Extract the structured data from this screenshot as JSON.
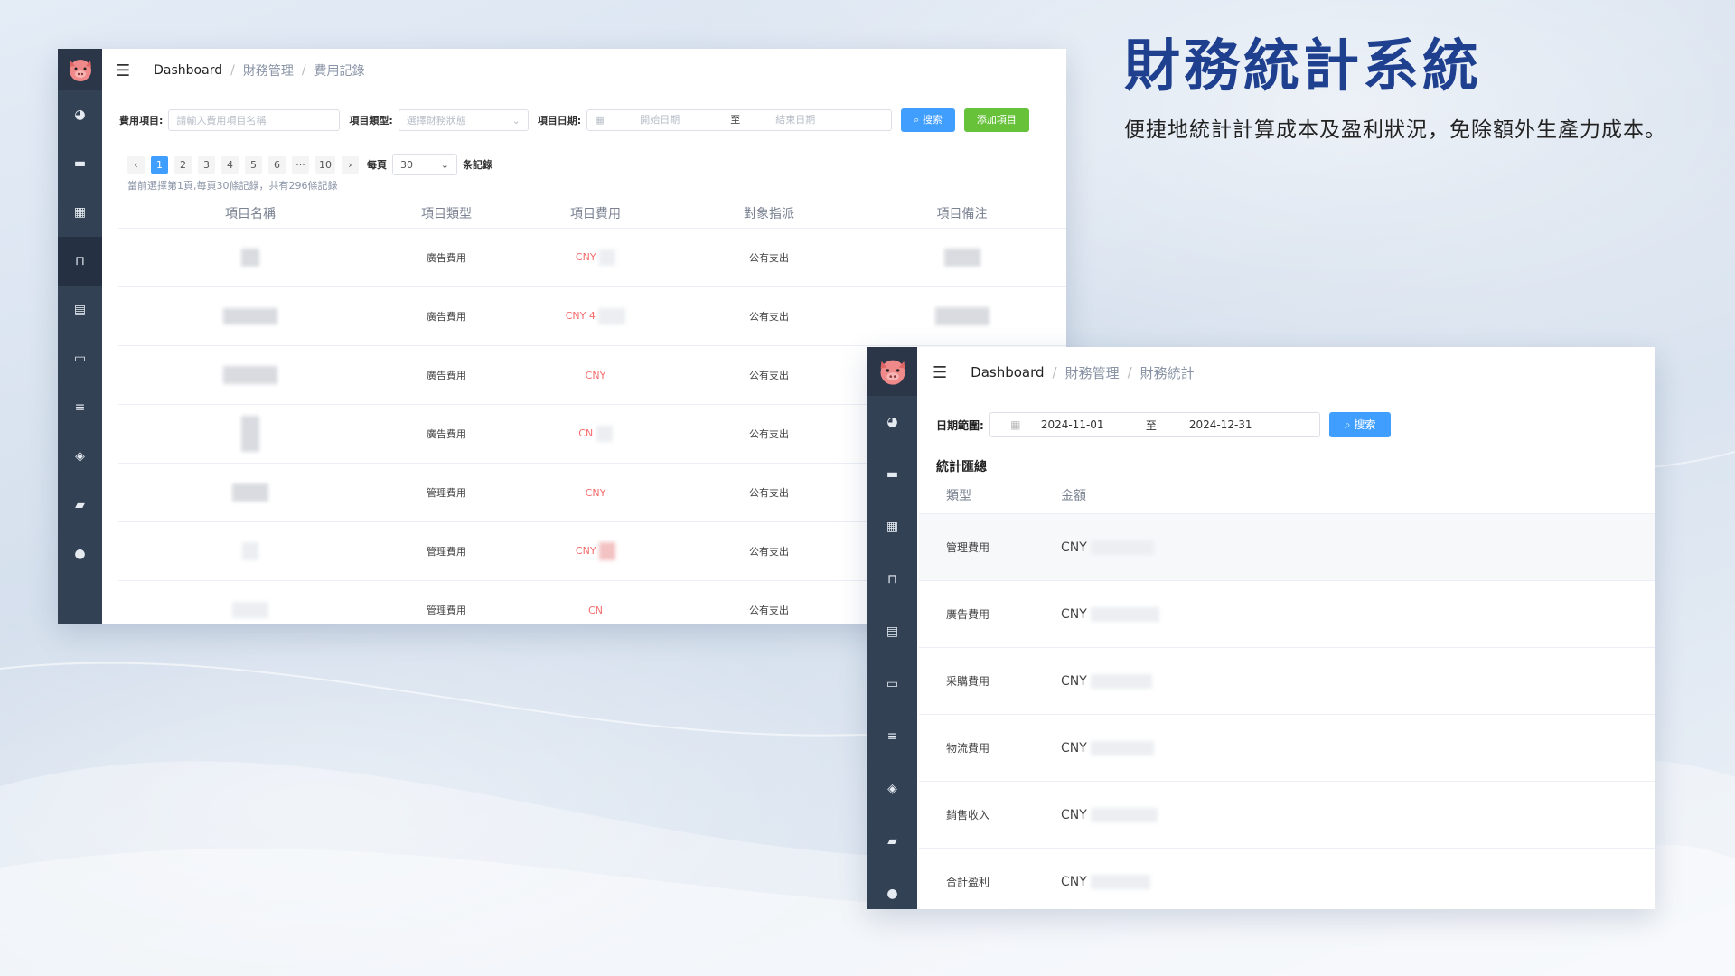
{
  "hero": {
    "title": "財務統計系統",
    "subtitle": "便捷地統計計算成本及盈利狀況，免除額外生產力成本。"
  },
  "colors": {
    "sidebar": "#334155",
    "primary": "#409eff",
    "success": "#67c23a",
    "danger": "#f56c6c",
    "title": "#1f3f8f"
  },
  "sidebar_icons": [
    "dashboard-icon",
    "monitor-icon",
    "grid-icon",
    "bag-icon",
    "clipboard-icon",
    "chat-icon",
    "list-icon",
    "box-icon",
    "wallet-icon",
    "user-icon"
  ],
  "window1": {
    "breadcrumb": {
      "home": "Dashboard",
      "section": "財務管理",
      "page": "費用記錄",
      "sep": "/"
    },
    "filters": {
      "item_label": "費用項目:",
      "item_placeholder": "請輸入費用項目名稱",
      "type_label": "項目類型:",
      "type_placeholder": "選擇財務狀態",
      "date_label": "項目日期:",
      "start_placeholder": "開始日期",
      "to": "至",
      "end_placeholder": "結束日期",
      "search_label": "搜索",
      "add_label": "添加項目"
    },
    "pagination": {
      "pages": [
        "1",
        "2",
        "3",
        "4",
        "5",
        "6",
        "···",
        "10"
      ],
      "current": "1",
      "per_page_label": "每頁",
      "per_page_value": "30",
      "unit_label": "条記錄",
      "info": "當前選擇第1頁,每頁30條記錄，共有296條記錄"
    },
    "columns": [
      "項目名稱",
      "項目類型",
      "項目費用",
      "對象指派",
      "項目備注"
    ],
    "rows": [
      {
        "type": "廣告費用",
        "cost": "CNY",
        "assignee": "公有支出"
      },
      {
        "type": "廣告費用",
        "cost": "CNY 4",
        "assignee": "公有支出"
      },
      {
        "type": "廣告費用",
        "cost": "CNY",
        "assignee": "公有支出"
      },
      {
        "type": "廣告費用",
        "cost": "CN",
        "assignee": "公有支出"
      },
      {
        "type": "管理費用",
        "cost": "CNY",
        "assignee": "公有支出"
      },
      {
        "type": "管理費用",
        "cost": "CNY",
        "assignee": "公有支出"
      },
      {
        "type": "管理費用",
        "cost": "CN",
        "assignee": "公有支出"
      }
    ]
  },
  "window2": {
    "breadcrumb": {
      "home": "Dashboard",
      "section": "財務管理",
      "page": "財務統計",
      "sep": "/"
    },
    "filters": {
      "range_label": "日期範圍:",
      "start": "2024-11-01",
      "to": "至",
      "end": "2024-12-31",
      "search_label": "搜索"
    },
    "summary_title": "統計匯總",
    "columns": [
      "類型",
      "金額"
    ],
    "rows": [
      {
        "type": "管理費用",
        "amount": "CNY"
      },
      {
        "type": "廣告費用",
        "amount": "CNY"
      },
      {
        "type": "采購費用",
        "amount": "CNY"
      },
      {
        "type": "物流費用",
        "amount": "CNY"
      },
      {
        "type": "銷售收入",
        "amount": "CNY"
      },
      {
        "type": "合計盈利",
        "amount": "CNY"
      }
    ]
  }
}
